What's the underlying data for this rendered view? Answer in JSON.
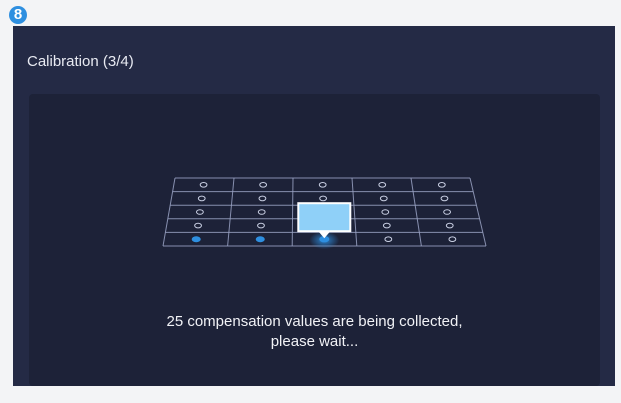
{
  "step": {
    "number": "8"
  },
  "header": {
    "title": "Calibration (3/4)"
  },
  "calibration": {
    "grid_rows": 5,
    "grid_cols": 5,
    "total_points": 25,
    "collected_points": 2,
    "active_point": 3
  },
  "message": {
    "line1": "25 compensation values are being collected,",
    "line2": "please wait..."
  },
  "colors": {
    "screen_bg": "#242a45",
    "panel_bg": "#1d2238",
    "grid_line": "#9aa3c4",
    "accent": "#2e8fe0",
    "probe": "#8fd0f8"
  },
  "icons": {
    "probe": "probe-head-icon",
    "step": "step-number-badge"
  }
}
